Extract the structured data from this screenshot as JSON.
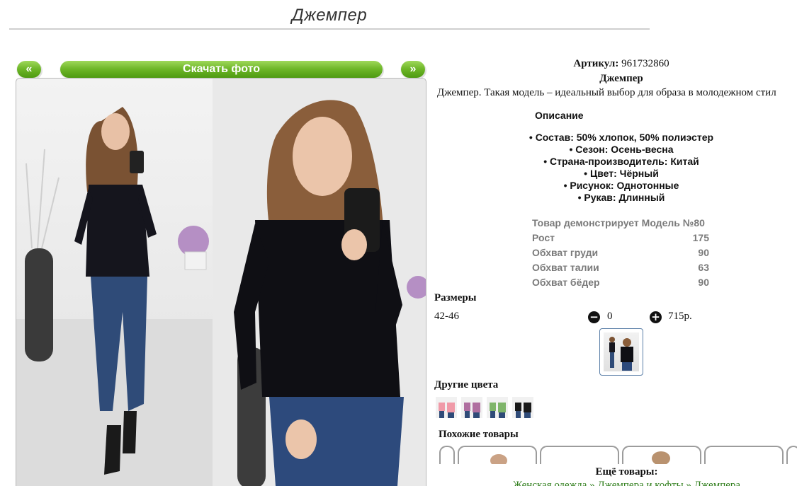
{
  "page": {
    "title": "Джемпер"
  },
  "gallery": {
    "prev_label": "«",
    "download_label": "Скачать фото",
    "next_label": "»"
  },
  "product": {
    "sku_label": "Артикул:",
    "sku_value": "961732860",
    "name": "Джемпер",
    "description": "Джемпер. Такая модель – идеальный выбор для образа в молодежном стил"
  },
  "details": {
    "heading": "Описание",
    "attributes": [
      "Состав: 50% хлопок, 50% полиэстер",
      "Сезон: Осень-весна",
      "Страна-производитель: Китай",
      "Цвет: Чёрный",
      "Рисунок: Однотонные",
      "Рукав: Длинный"
    ]
  },
  "model": {
    "heading": "Товар демонстрирует Модель №80",
    "rows": [
      {
        "label": "Рост",
        "value": "175"
      },
      {
        "label": "Обхват груди",
        "value": "90"
      },
      {
        "label": "Обхват талии",
        "value": "63"
      },
      {
        "label": "Обхват бёдер",
        "value": "90"
      }
    ]
  },
  "sizes": {
    "heading": "Размеры",
    "size": "42-46",
    "minus_icon": "minus-circle-icon",
    "quantity": "0",
    "plus_icon": "plus-circle-icon",
    "price": "715р."
  },
  "other_colors": {
    "heading": "Другие цвета",
    "swatches": [
      "pink",
      "mauve",
      "green",
      "black"
    ],
    "swatch_colors": [
      "#f09aa8",
      "#b06fa0",
      "#7fb56a",
      "#1a1a1a"
    ]
  },
  "similar": {
    "heading": "Похожие товары"
  },
  "more": {
    "heading": "Ещё товары:",
    "links": [
      "Женская одежда",
      "Джемпера и кофты",
      "Джемпера"
    ],
    "separator": " » "
  },
  "colors": {
    "accent_green": "#6cb526",
    "link_green": "#2e7d1a",
    "muted": "#7a7a7a"
  }
}
